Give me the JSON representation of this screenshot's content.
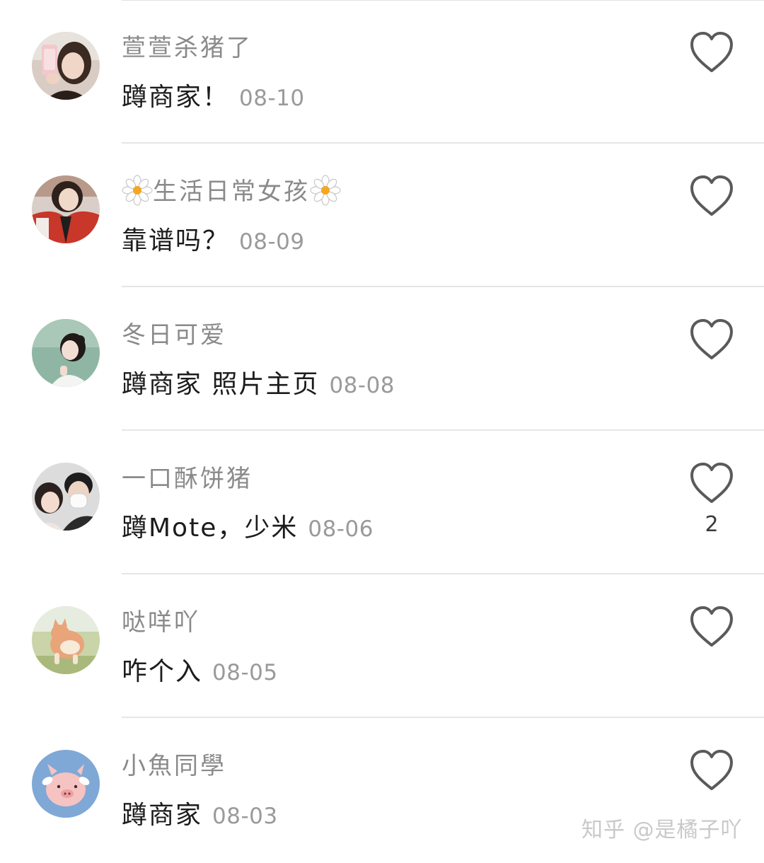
{
  "comments": [
    {
      "username": "萱萱杀猪了",
      "text": "蹲商家！",
      "date": "08-10",
      "like_count": "",
      "avatar": "avatar-photo-girl-selfie"
    },
    {
      "username": "生活日常女孩",
      "username_decoration": "daisy-icon",
      "text": "靠谱吗？",
      "date": "08-09",
      "like_count": "",
      "avatar": "avatar-photo-girl-red"
    },
    {
      "username": "冬日可爱",
      "text": "蹲商家 照片主页",
      "date": "08-08",
      "like_count": "",
      "avatar": "avatar-photo-girl-lake"
    },
    {
      "username": "一口酥饼猪",
      "text": "蹲Mote，少米",
      "date": "08-06",
      "like_count": "2",
      "avatar": "avatar-photo-couple"
    },
    {
      "username": "哒咩吖",
      "text": "咋个入",
      "date": "08-05",
      "like_count": "",
      "avatar": "avatar-photo-corgi"
    },
    {
      "username": "小魚同學",
      "text": "蹲商家",
      "date": "08-03",
      "like_count": "",
      "avatar": "avatar-pig-cartoon"
    }
  ],
  "watermark": "知乎 @是橘子吖",
  "colors": {
    "username": "#8a8a8a",
    "text": "#1c1c1c",
    "date": "#9a9a9a",
    "divider": "#e6e6e6",
    "like_icon": "#5a5a5a",
    "watermark": "#c9c9c9"
  }
}
